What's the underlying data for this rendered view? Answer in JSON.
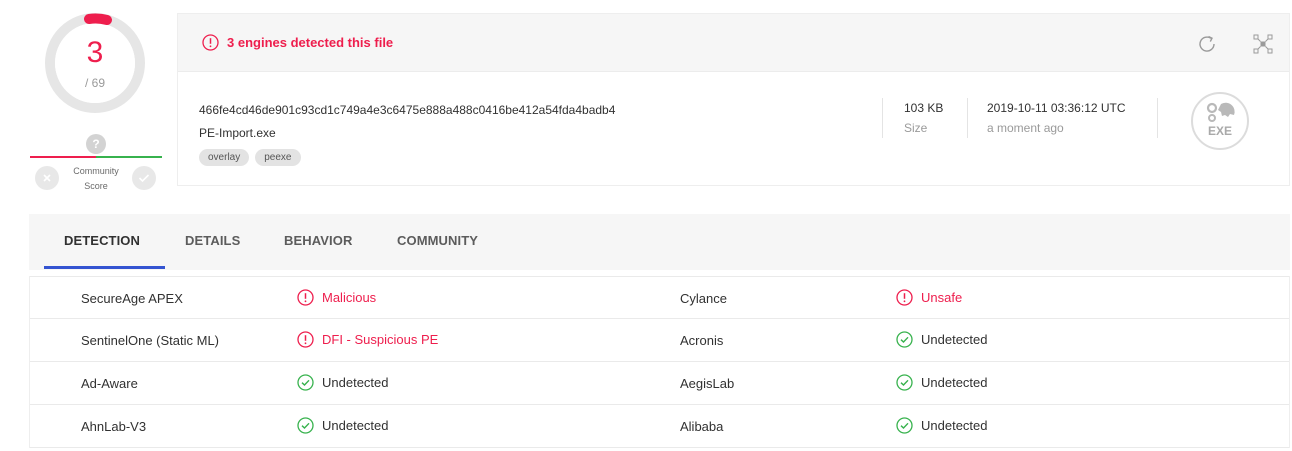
{
  "score": {
    "detected": "3",
    "total": "/ 69"
  },
  "community": {
    "label_line1": "Community",
    "label_line2": "Score",
    "unknown": "?"
  },
  "alert": {
    "text": "3 engines detected this file"
  },
  "file": {
    "hash": "466fe4cd46de901c93cd1c749a4e3c6475e888a488c0416be412a54fda4badb4",
    "name": "PE-Import.exe",
    "tags": [
      "overlay",
      "peexe"
    ],
    "size": "103 KB",
    "size_label": "Size",
    "date": "2019-10-11 03:36:12 UTC",
    "date_label": "a moment ago",
    "type_badge": "EXE"
  },
  "tabs": [
    "DETECTION",
    "DETAILS",
    "BEHAVIOR",
    "COMMUNITY"
  ],
  "detections": [
    {
      "engine_a": "SecureAge APEX",
      "result_a": "Malicious",
      "status_a": "bad",
      "engine_b": "Cylance",
      "result_b": "Unsafe",
      "status_b": "bad"
    },
    {
      "engine_a": "SentinelOne (Static ML)",
      "result_a": "DFI - Suspicious PE",
      "status_a": "bad",
      "engine_b": "Acronis",
      "result_b": "Undetected",
      "status_b": "ok"
    },
    {
      "engine_a": "Ad-Aware",
      "result_a": "Undetected",
      "status_a": "ok",
      "engine_b": "AegisLab",
      "result_b": "Undetected",
      "status_b": "ok"
    },
    {
      "engine_a": "AhnLab-V3",
      "result_a": "Undetected",
      "status_a": "ok",
      "engine_b": "Alibaba",
      "result_b": "Undetected",
      "status_b": "ok"
    }
  ],
  "colors": {
    "malicious": "#ee1e4d",
    "clean": "#37b24d",
    "tab_indicator": "#3454d1"
  },
  "icons": {
    "alert": "alert-circle-icon",
    "ok": "check-circle-icon",
    "reload": "reload-icon",
    "graph": "graph-icon"
  }
}
